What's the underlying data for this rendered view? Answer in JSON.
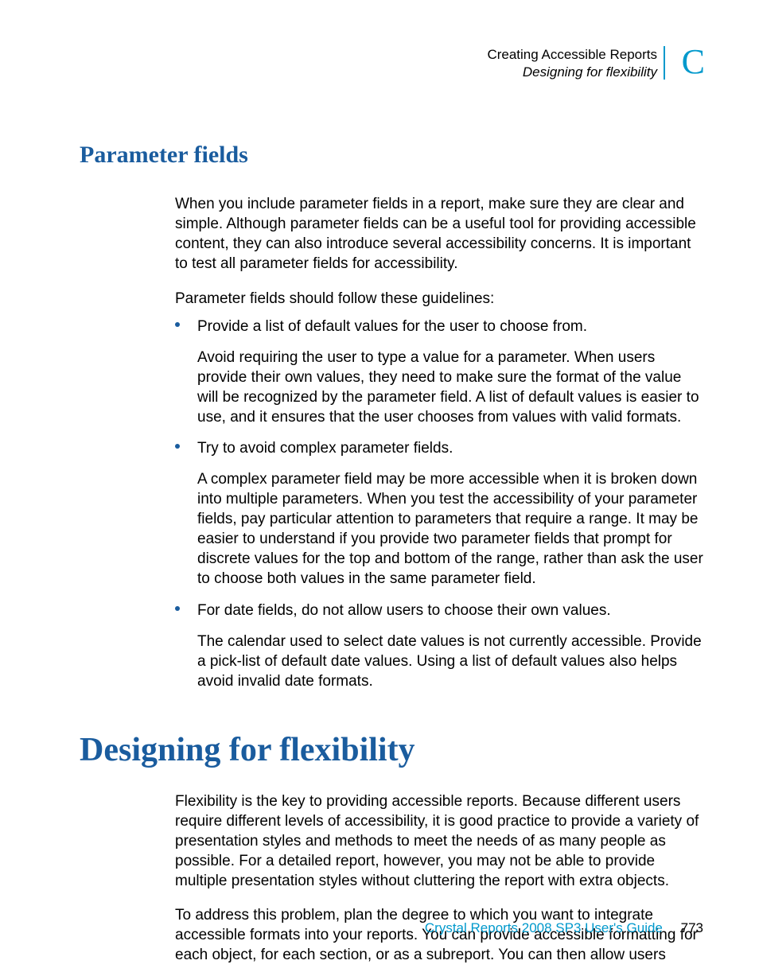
{
  "header": {
    "line1": "Creating Accessible Reports",
    "line2": "Designing for flexibility",
    "appendix_letter": "C"
  },
  "section1": {
    "title": "Parameter fields",
    "para1": "When you include parameter fields in a report, make sure they are clear and simple. Although parameter fields can be a useful tool for providing accessible content, they can also introduce several accessibility concerns. It is important to test all parameter fields for accessibility.",
    "para2": "Parameter fields should follow these guidelines:",
    "bullets": [
      {
        "lead": "Provide a list of default values for the user to choose from.",
        "sub": "Avoid requiring the user to type a value for a parameter. When users provide their own values, they need to make sure the format of the value will be recognized by the parameter field. A list of default values is easier to use, and it ensures that the user chooses from values with valid formats."
      },
      {
        "lead": "Try to avoid complex parameter fields.",
        "sub": "A complex parameter field may be more accessible when it is broken down into multiple parameters. When you test the accessibility of your parameter fields, pay particular attention to parameters that require a range. It may be easier to understand if you provide two parameter fields that prompt for discrete values for the top and bottom of the range, rather than ask the user to choose both values in the same parameter field."
      },
      {
        "lead": "For date fields, do not allow users to choose their own values.",
        "sub": "The calendar used to select date values is not currently accessible. Provide a pick-list of default date values. Using a list of default values also helps avoid invalid date formats."
      }
    ]
  },
  "section2": {
    "title": "Designing for flexibility",
    "para1": "Flexibility is the key to providing accessible reports. Because different users require different levels of accessibility, it is good practice to provide a variety of presentation styles and methods to meet the needs of as many people as possible. For a detailed report, however, you may not be able to provide multiple presentation styles without cluttering the report with extra objects.",
    "para2": "To address this problem, plan the degree to which you want to integrate accessible formats into your reports. You can provide accessible formatting for each object, for each section, or as a subreport. You can then allow users"
  },
  "footer": {
    "title": "Crystal Reports 2008 SP3 User's Guide",
    "page": "773"
  }
}
